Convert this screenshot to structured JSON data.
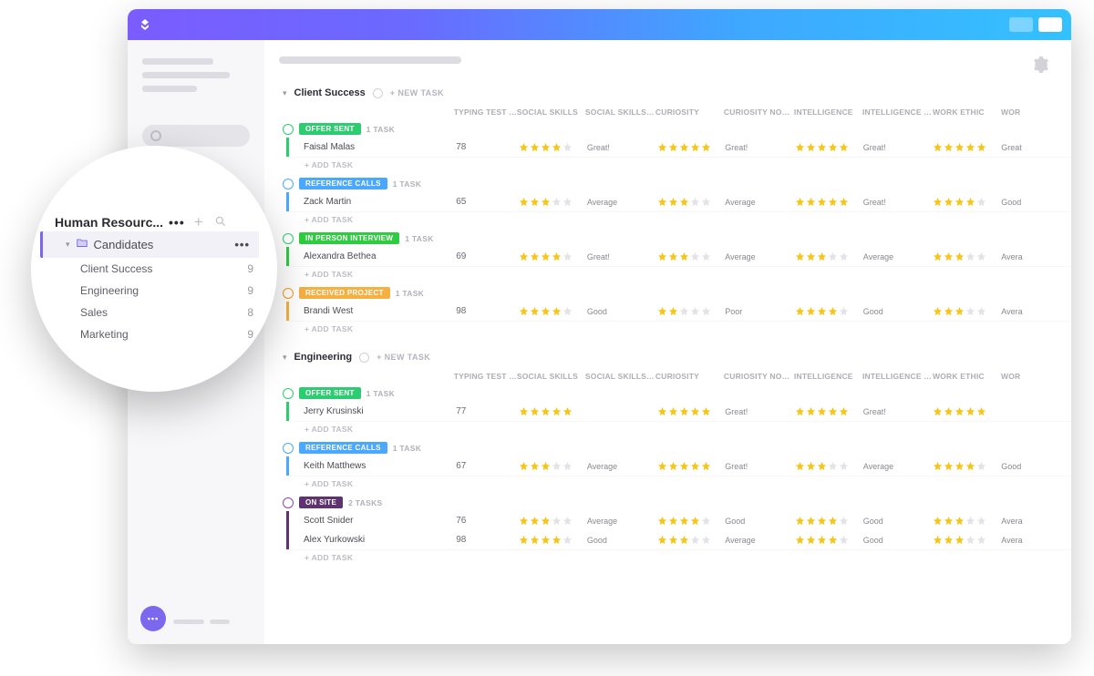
{
  "popout": {
    "title": "Human Resourc...",
    "active": {
      "label": "Candidates"
    },
    "subs": [
      {
        "label": "Client Success",
        "count": "9"
      },
      {
        "label": "Engineering",
        "count": "9"
      },
      {
        "label": "Sales",
        "count": "8"
      },
      {
        "label": "Marketing",
        "count": "9"
      }
    ]
  },
  "labels": {
    "new_task": "+ NEW TASK",
    "add_task": "+ ADD TASK"
  },
  "columns": {
    "typing": "TYPING TEST WPM",
    "social": "SOCIAL SKILLS",
    "social_notes": "SOCIAL SKILLS NOTES",
    "curiosity": "CURIOSITY",
    "curiosity_notes": "CURIOSITY NOTES",
    "intelligence": "INTELLIGENCE",
    "intelligence_notes": "INTELLIGENCE NOTES",
    "work_ethic": "WORK ETHIC",
    "work_last": "WOR"
  },
  "statuses": {
    "offer_sent": {
      "label": "OFFER SENT",
      "color": "#2ecc71",
      "circle": "grn"
    },
    "reference_calls": {
      "label": "REFERENCE CALLS",
      "color": "#4aa8ff",
      "circle": "blu"
    },
    "in_person": {
      "label": "IN PERSON INTERVIEW",
      "color": "#2ecc40",
      "circle": "grn"
    },
    "received_project": {
      "label": "RECEIVED PROJECT",
      "color": "#f5b041",
      "circle": "org"
    },
    "on_site": {
      "label": "ON SITE",
      "color": "#5e3370",
      "circle": "prp"
    }
  },
  "sections": [
    {
      "title": "Client Success",
      "groups": [
        {
          "status": "offer_sent",
          "task_count": "1 TASK",
          "rows": [
            {
              "name": "Faisal Malas",
              "wpm": "78",
              "social": 4,
              "social_note": "Great!",
              "curiosity": 5,
              "curiosity_note": "Great!",
              "intel": 5,
              "intel_note": "Great!",
              "we": 5,
              "we_note": "Great"
            }
          ]
        },
        {
          "status": "reference_calls",
          "task_count": "1 TASK",
          "rows": [
            {
              "name": "Zack Martin",
              "wpm": "65",
              "social": 3,
              "social_note": "Average",
              "curiosity": 3,
              "curiosity_note": "Average",
              "intel": 5,
              "intel_note": "Great!",
              "we": 4,
              "we_note": "Good"
            }
          ]
        },
        {
          "status": "in_person",
          "task_count": "1 TASK",
          "rows": [
            {
              "name": "Alexandra Bethea",
              "wpm": "69",
              "social": 4,
              "social_note": "Great!",
              "curiosity": 3,
              "curiosity_note": "Average",
              "intel": 3,
              "intel_note": "Average",
              "we": 3,
              "we_note": "Avera"
            }
          ]
        },
        {
          "status": "received_project",
          "task_count": "1 TASK",
          "rows": [
            {
              "name": "Brandi West",
              "wpm": "98",
              "social": 4,
              "social_note": "Good",
              "curiosity": 2,
              "curiosity_note": "Poor",
              "intel": 4,
              "intel_note": "Good",
              "we": 3,
              "we_note": "Avera"
            }
          ]
        }
      ]
    },
    {
      "title": "Engineering",
      "groups": [
        {
          "status": "offer_sent",
          "task_count": "1 TASK",
          "rows": [
            {
              "name": "Jerry Krusinski",
              "wpm": "77",
              "social": 5,
              "social_note": "",
              "curiosity": 5,
              "curiosity_note": "Great!",
              "intel": 5,
              "intel_note": "Great!",
              "we": 5,
              "we_note": ""
            }
          ]
        },
        {
          "status": "reference_calls",
          "task_count": "1 TASK",
          "rows": [
            {
              "name": "Keith Matthews",
              "wpm": "67",
              "social": 3,
              "social_note": "Average",
              "curiosity": 5,
              "curiosity_note": "Great!",
              "intel": 3,
              "intel_note": "Average",
              "we": 4,
              "we_note": "Good"
            }
          ]
        },
        {
          "status": "on_site",
          "task_count": "2 TASKS",
          "rows": [
            {
              "name": "Scott Snider",
              "wpm": "76",
              "social": 3,
              "social_note": "Average",
              "curiosity": 4,
              "curiosity_note": "Good",
              "intel": 4,
              "intel_note": "Good",
              "we": 3,
              "we_note": "Avera"
            },
            {
              "name": "Alex Yurkowski",
              "wpm": "98",
              "social": 4,
              "social_note": "Good",
              "curiosity": 3,
              "curiosity_note": "Average",
              "intel": 4,
              "intel_note": "Good",
              "we": 3,
              "we_note": "Avera"
            }
          ]
        }
      ]
    }
  ]
}
